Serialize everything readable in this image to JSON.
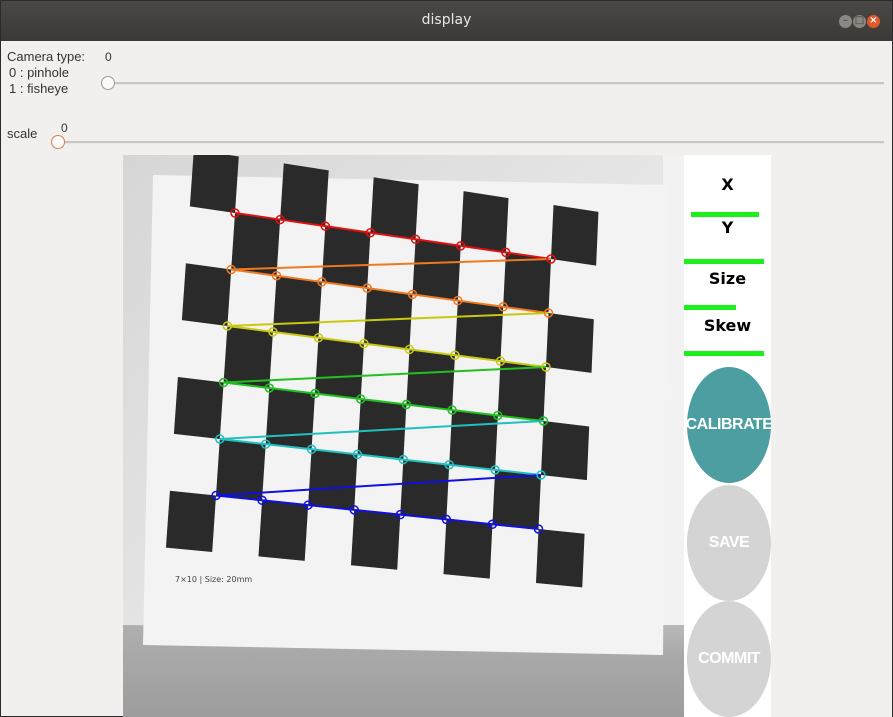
{
  "window": {
    "title": "display"
  },
  "controls": {
    "camera_type": {
      "label": "Camera type:",
      "value": "0",
      "option0": "0 : pinhole",
      "option1": "1 : fisheye",
      "level": 0
    },
    "scale": {
      "label": "scale",
      "value": "0",
      "level": 0
    }
  },
  "camera_view": {
    "board_label": "7×10  |  Size: 20mm",
    "board_rows": 6,
    "corners_per_row": 8,
    "row_colors": [
      "#e01010",
      "#f07820",
      "#c8c810",
      "#20c020",
      "#20c0c0",
      "#1010e0"
    ]
  },
  "panel": {
    "metrics": [
      {
        "label": "X",
        "progress": 0.85,
        "color": "#1cf01c"
      },
      {
        "label": "Y",
        "progress": 1.0,
        "color": "#1cf01c"
      },
      {
        "label": "Size",
        "progress": 0.65,
        "color": "#1cf01c"
      },
      {
        "label": "Skew",
        "progress": 1.0,
        "color": "#1cf01c"
      }
    ],
    "buttons": {
      "calibrate": {
        "label": "CALIBRATE",
        "color": "#4d9ea0",
        "enabled": true
      },
      "save": {
        "label": "SAVE",
        "color": "#d4d4d4",
        "enabled": false
      },
      "commit": {
        "label": "COMMIT",
        "color": "#d4d4d4",
        "enabled": false
      }
    }
  }
}
